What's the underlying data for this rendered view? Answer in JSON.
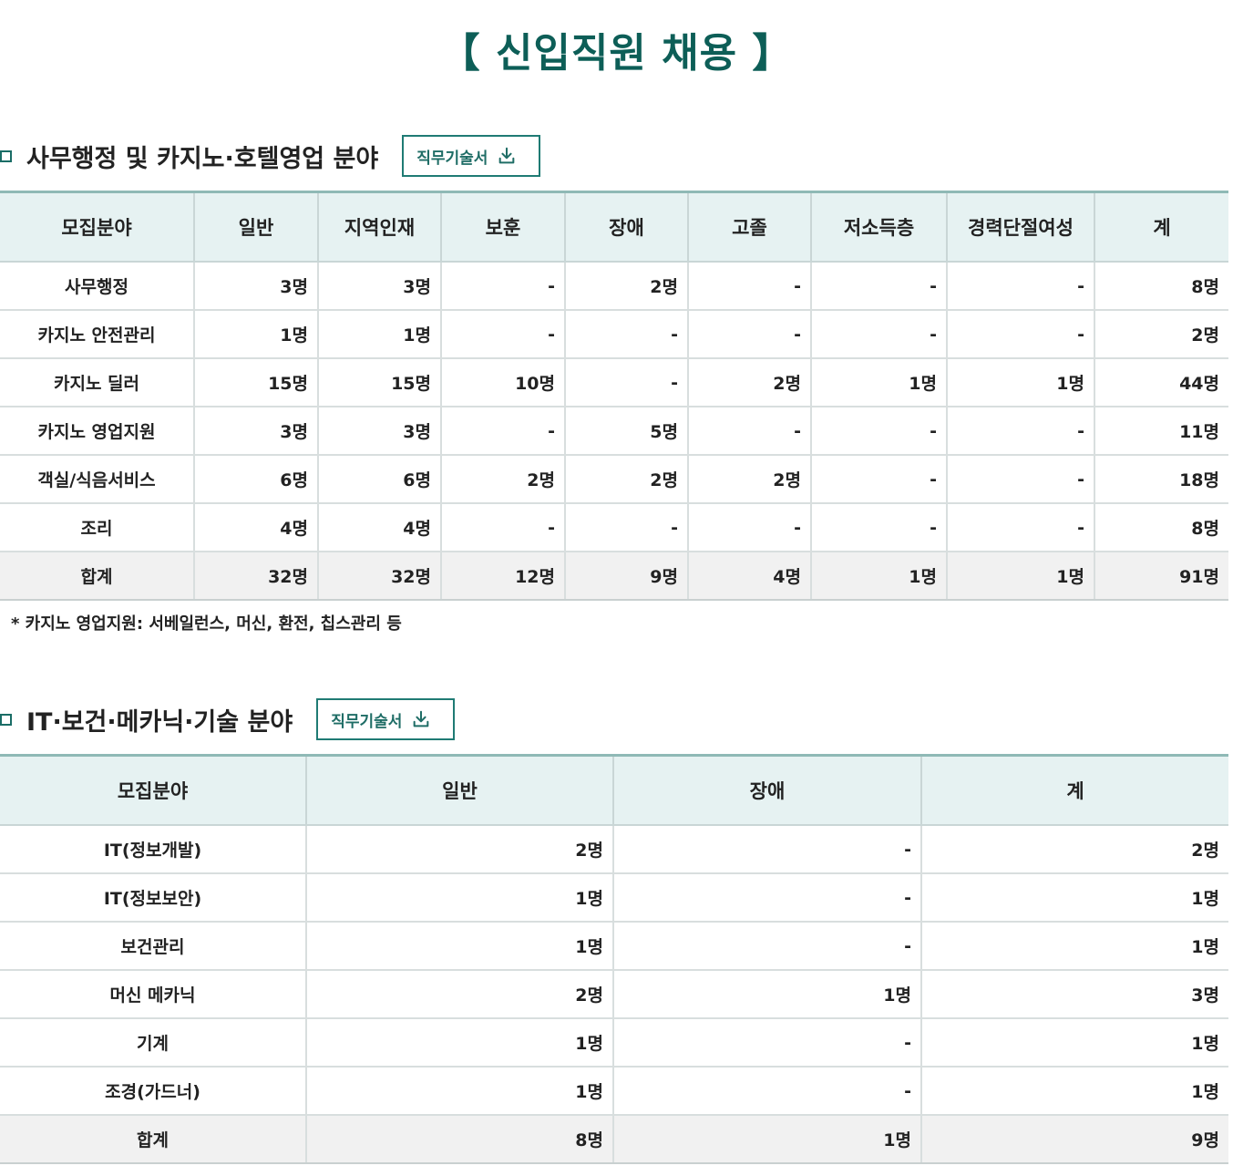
{
  "page_title": "【 신입직원 채용 】",
  "section1": {
    "title": "사무행정 및 카지노·호텔영업 분야",
    "button_label": "직무기술서",
    "headers": [
      "모집분야",
      "일반",
      "지역인재",
      "보훈",
      "장애",
      "고졸",
      "저소득층",
      "경력단절여성",
      "계"
    ],
    "rows": [
      [
        "사무행정",
        "3명",
        "3명",
        "-",
        "2명",
        "-",
        "-",
        "-",
        "8명"
      ],
      [
        "카지노 안전관리",
        "1명",
        "1명",
        "-",
        "-",
        "-",
        "-",
        "-",
        "2명"
      ],
      [
        "카지노 딜러",
        "15명",
        "15명",
        "10명",
        "-",
        "2명",
        "1명",
        "1명",
        "44명"
      ],
      [
        "카지노 영업지원",
        "3명",
        "3명",
        "-",
        "5명",
        "-",
        "-",
        "-",
        "11명"
      ],
      [
        "객실/식음서비스",
        "6명",
        "6명",
        "2명",
        "2명",
        "2명",
        "-",
        "-",
        "18명"
      ],
      [
        "조리",
        "4명",
        "4명",
        "-",
        "-",
        "-",
        "-",
        "-",
        "8명"
      ]
    ],
    "total": [
      "합계",
      "32명",
      "32명",
      "12명",
      "9명",
      "4명",
      "1명",
      "1명",
      "91명"
    ],
    "note": "* 카지노 영업지원: 서베일런스, 머신, 환전, 칩스관리 등"
  },
  "section2": {
    "title": "IT·보건·메카닉·기술 분야",
    "button_label": "직무기술서",
    "headers": [
      "모집분야",
      "일반",
      "장애",
      "계"
    ],
    "rows": [
      [
        "IT(정보개발)",
        "2명",
        "-",
        "2명"
      ],
      [
        "IT(정보보안)",
        "1명",
        "-",
        "1명"
      ],
      [
        "보건관리",
        "1명",
        "-",
        "1명"
      ],
      [
        "머신 메카닉",
        "2명",
        "1명",
        "3명"
      ],
      [
        "기계",
        "1명",
        "-",
        "1명"
      ],
      [
        "조경(가드너)",
        "1명",
        "-",
        "1명"
      ]
    ],
    "total": [
      "합계",
      "8명",
      "1명",
      "9명"
    ]
  },
  "colors": {
    "accent": "#0d5e57",
    "header_bg": "#e6f2f2",
    "total_bg": "#f1f1f1"
  },
  "icons": {
    "section_marker": "square-bullet-icon",
    "download": "download-icon"
  }
}
